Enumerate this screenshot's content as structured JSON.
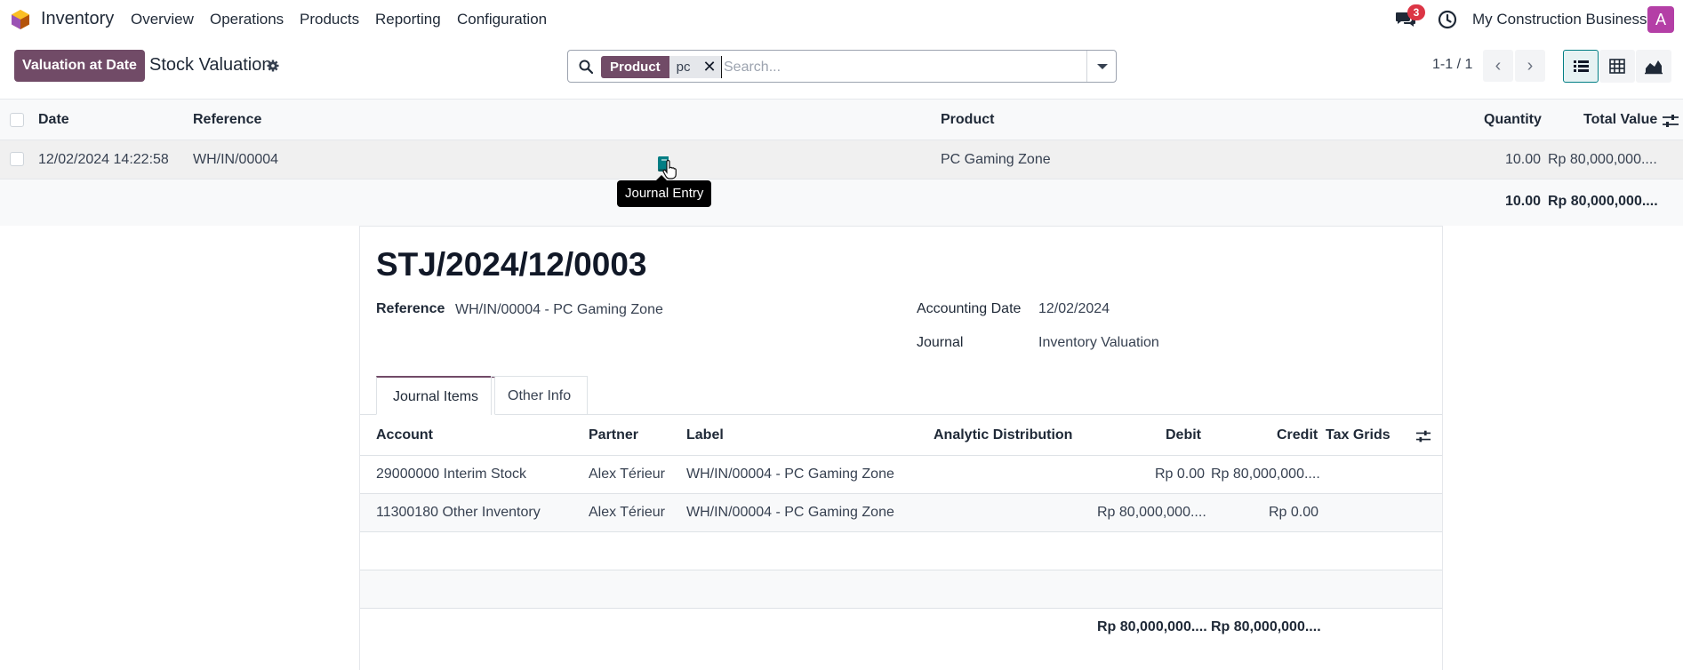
{
  "navbar": {
    "app_name": "Inventory",
    "menu": [
      "Overview",
      "Operations",
      "Products",
      "Reporting",
      "Configuration"
    ],
    "messages_badge": "3",
    "company": "My Construction Business",
    "avatar_letter": "A"
  },
  "control_panel": {
    "primary_button": "Valuation at Date",
    "title": "Stock Valuation",
    "search": {
      "facet_label": "Product",
      "facet_value": "pc",
      "placeholder": "Search..."
    },
    "pager": "1-1 / 1"
  },
  "list": {
    "columns": [
      "Date",
      "Reference",
      "Product",
      "Quantity",
      "Total Value"
    ],
    "rows": [
      {
        "date": "12/02/2024 14:22:58",
        "reference": "WH/IN/00004",
        "product": "PC Gaming Zone",
        "quantity": "10.00",
        "total_value": "Rp 80,000,000...."
      }
    ],
    "totals": {
      "quantity": "10.00",
      "total_value": "Rp 80,000,000...."
    },
    "tooltip": "Journal Entry"
  },
  "journal_entry": {
    "name": "STJ/2024/12/0003",
    "reference_label": "Reference",
    "reference_value": "WH/IN/00004 - PC Gaming Zone",
    "accounting_date_label": "Accounting Date",
    "accounting_date_value": "12/02/2024",
    "journal_label": "Journal",
    "journal_value": "Inventory Valuation",
    "tabs": [
      "Journal Items",
      "Other Info"
    ],
    "item_columns": [
      "Account",
      "Partner",
      "Label",
      "Analytic Distribution",
      "Debit",
      "Credit",
      "Tax Grids"
    ],
    "items": [
      {
        "account": "29000000 Interim Stock",
        "partner": "Alex Térieur",
        "label": "WH/IN/00004 - PC Gaming Zone",
        "debit": "Rp 0.00",
        "credit": "Rp 80,000,000...."
      },
      {
        "account": "11300180 Other Inventory",
        "partner": "Alex Térieur",
        "label": "WH/IN/00004 - PC Gaming Zone",
        "debit": "Rp 80,000,000....",
        "credit": "Rp 0.00"
      }
    ],
    "totals": {
      "debit": "Rp 80,000,000....",
      "credit": "Rp 80,000,000...."
    }
  },
  "colors": {
    "brand": "#714b67",
    "accent": "#017e84",
    "badge": "#dc3545",
    "avatar": "#b43fa6"
  }
}
